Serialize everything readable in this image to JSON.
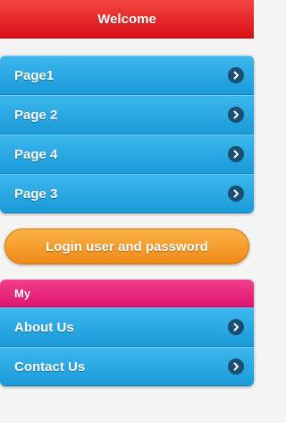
{
  "header": {
    "title": "Welcome"
  },
  "main_list": {
    "items": [
      {
        "label": "Page1"
      },
      {
        "label": "Page 2"
      },
      {
        "label": "Page 4"
      },
      {
        "label": "Page 3"
      }
    ]
  },
  "login_button": {
    "label": "Login user and password"
  },
  "secondary_list": {
    "divider": "My",
    "items": [
      {
        "label": "About Us"
      },
      {
        "label": "Contact Us"
      }
    ]
  },
  "icons": {
    "list_arrow": "chevron-right-circle-icon"
  },
  "colors": {
    "header": "#e01b22",
    "list_item": "#26a7e3",
    "divider": "#e8207a",
    "login_button": "#f5a021",
    "arrow_circle": "#1a4f72"
  }
}
